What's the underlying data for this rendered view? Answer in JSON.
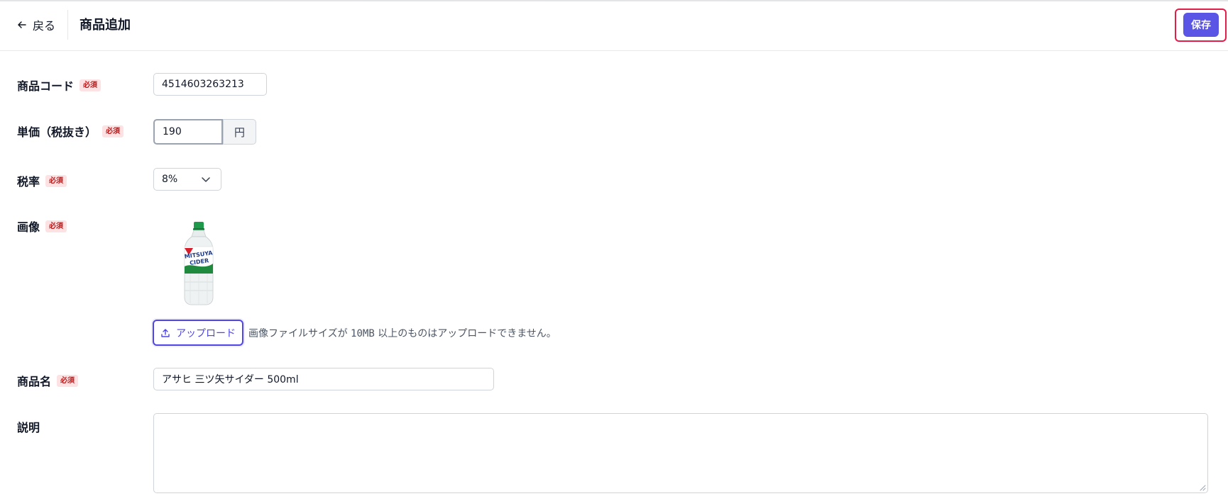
{
  "header": {
    "back_label": "戻る",
    "title": "商品追加",
    "save_label": "保存"
  },
  "form": {
    "product_code": {
      "label": "商品コード",
      "required": "必須",
      "value": "4514603263213"
    },
    "unit_price": {
      "label": "単価（税抜き）",
      "required": "必須",
      "value": "190",
      "unit": "円"
    },
    "tax_rate": {
      "label": "税率",
      "required": "必須",
      "selected": "8%"
    },
    "image": {
      "label": "画像",
      "required": "必須",
      "upload_label": "アップロード",
      "note_prefix": "画像ファイルサイズが",
      "note_size": "10MB",
      "note_suffix": "以上のものはアップロードできません。"
    },
    "product_name": {
      "label": "商品名",
      "required": "必須",
      "value": "アサヒ 三ツ矢サイダー 500ml"
    },
    "description": {
      "label": "説明",
      "value": ""
    }
  },
  "colors": {
    "primary": "#5b55e6",
    "focus_ring": "#e11d48",
    "required_text": "#b91c1c",
    "required_bg": "#fde2e4"
  }
}
